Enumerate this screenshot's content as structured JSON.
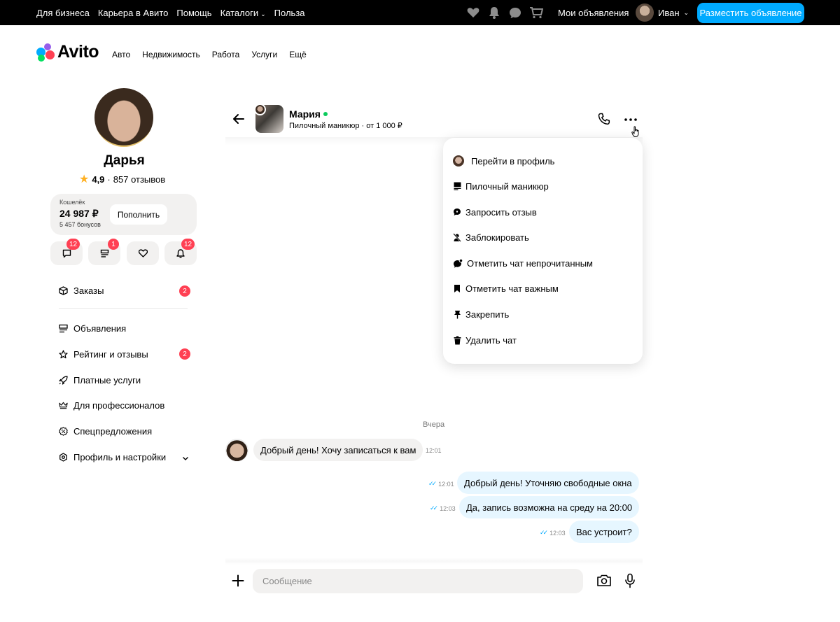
{
  "topbar": {
    "links": [
      "Для бизнеса",
      "Карьера в Авито",
      "Помощь",
      "Каталоги",
      "Польза"
    ],
    "my_ads": "Мои объявления",
    "user_name": "Иван",
    "post_button": "Разместить объявление",
    "icons": [
      "heart-icon",
      "bell-icon",
      "chat-icon",
      "cart-icon"
    ]
  },
  "logo": {
    "text": "Avito"
  },
  "categories": [
    "Авто",
    "Недвижимость",
    "Работа",
    "Услуги",
    "Ещё"
  ],
  "profile": {
    "name": "Дарья",
    "rating": "4,9",
    "reviews": "857 отзывов",
    "wallet": {
      "label": "Кошелёк",
      "amount": "24 987 ₽",
      "bonus": "5 457 бонусов",
      "topup_label": "Пополнить"
    },
    "quick_actions": [
      {
        "icon": "messages-icon",
        "badge": "12"
      },
      {
        "icon": "listings-icon",
        "badge": "1"
      },
      {
        "icon": "favorites-icon",
        "badge": ""
      },
      {
        "icon": "notifications-icon",
        "badge": "12"
      }
    ]
  },
  "menu": [
    {
      "label": "Заказы",
      "icon": "box-icon",
      "badge": "2"
    },
    {
      "label": "Объявления",
      "icon": "listings-icon",
      "badge": ""
    },
    {
      "label": "Рейтинг и отзывы",
      "icon": "star-icon",
      "badge": "2"
    },
    {
      "label": "Платные услуги",
      "icon": "rocket-icon",
      "badge": ""
    },
    {
      "label": "Для профессионалов",
      "icon": "crown-icon",
      "badge": ""
    },
    {
      "label": "Спецпредложения",
      "icon": "percent-icon",
      "badge": ""
    },
    {
      "label": "Профиль и настройки",
      "icon": "settings-icon",
      "badge": ""
    }
  ],
  "chat": {
    "contact_name": "Мария",
    "listing": "Пилочный маникюр · от 1 000 ₽",
    "dropdown": [
      {
        "label": "Перейти в профиль",
        "icon": "avatar-icon"
      },
      {
        "label": "Пилочный маникюр",
        "icon": "listing-icon"
      },
      {
        "label": "Запросить отзыв",
        "icon": "review-request-icon"
      },
      {
        "label": "Заблокировать",
        "icon": "block-icon"
      },
      {
        "label": "Отметить чат непрочитанным",
        "icon": "unread-icon"
      },
      {
        "label": "Отметить чат важным",
        "icon": "bookmark-icon"
      },
      {
        "label": "Закрепить",
        "icon": "pin-icon"
      },
      {
        "label": "Удалить чат",
        "icon": "trash-icon"
      }
    ],
    "day_label": "Вчера",
    "messages": [
      {
        "direction": "in",
        "text": "Добрый день! Хочу записаться к вам",
        "time": "12:01"
      },
      {
        "direction": "out",
        "text": "Добрый день! Уточняю свободные окна",
        "time": "12:01"
      },
      {
        "direction": "out",
        "text": "Да, запись возможна на среду на 20:00",
        "time": "12:03"
      },
      {
        "direction": "out",
        "text": "Вас устроит?",
        "time": "12:03"
      }
    ],
    "input_placeholder": "Сообщение"
  },
  "colors": {
    "accent": "#00aaff",
    "badge": "#ff4053",
    "online": "#0bcb5c",
    "star": "#ffb021",
    "bubble_in": "#f2f1f0",
    "bubble_out": "#e6f6ff"
  }
}
